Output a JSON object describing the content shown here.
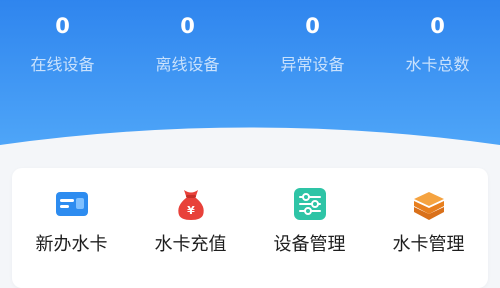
{
  "colors": {
    "header_top": "#2f85ee",
    "header_bottom": "#4da4f7",
    "page_bg": "#f4f6f9",
    "card_icon_blue": "#2d8cf0",
    "wallet_icon_red": "#e8413a",
    "settings_icon_teal": "#2ec4a6",
    "layers_icon_orange": "#f08a1c"
  },
  "stats": [
    {
      "value": "0",
      "label": "在线设备"
    },
    {
      "value": "0",
      "label": "离线设备"
    },
    {
      "value": "0",
      "label": "异常设备"
    },
    {
      "value": "0",
      "label": "水卡总数"
    }
  ],
  "actions": [
    {
      "label": "新办水卡",
      "icon": "card-icon"
    },
    {
      "label": "水卡充值",
      "icon": "money-bag-icon"
    },
    {
      "label": "设备管理",
      "icon": "sliders-icon"
    },
    {
      "label": "水卡管理",
      "icon": "layers-icon"
    }
  ]
}
